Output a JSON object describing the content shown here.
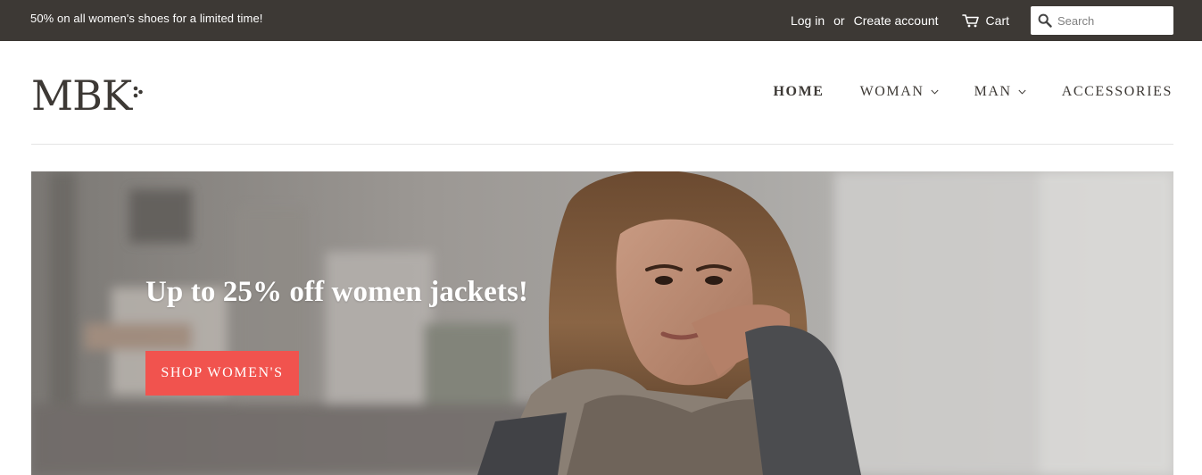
{
  "announcement": {
    "text": "50% on all women's shoes for a limited time!"
  },
  "account": {
    "login_label": "Log in",
    "or_label": "or",
    "create_account_label": "Create account"
  },
  "cart": {
    "label": "Cart",
    "icon": "cart-icon"
  },
  "search": {
    "placeholder": "Search",
    "value": "",
    "icon": "search-icon"
  },
  "logo": {
    "text": "MBK"
  },
  "nav": {
    "items": [
      {
        "label": "HOME",
        "active": true,
        "has_dropdown": false
      },
      {
        "label": "WOMAN",
        "active": false,
        "has_dropdown": true
      },
      {
        "label": "MAN",
        "active": false,
        "has_dropdown": true
      },
      {
        "label": "ACCESSORIES",
        "active": false,
        "has_dropdown": false
      }
    ]
  },
  "hero": {
    "heading": "Up to 25% off women jackets!",
    "button_label": "SHOP WOMEN'S",
    "image": "woman-portrait-photo"
  },
  "colors": {
    "announcement_bg": "#3d3935",
    "text_dark": "#3d3935",
    "accent": "#f1534e",
    "divider": "#e4e4e4"
  }
}
